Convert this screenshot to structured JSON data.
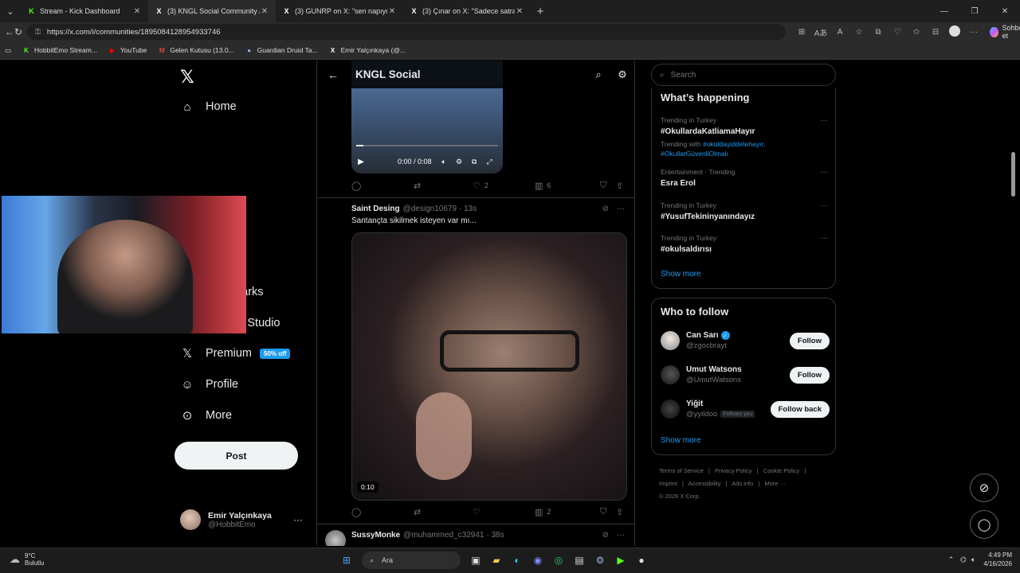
{
  "browser": {
    "tabs": [
      {
        "title": "Stream - Kick Dashboard",
        "icon": "K",
        "kind": "kick"
      },
      {
        "title": "(3) KNGL Social Community / X",
        "icon": "X",
        "kind": "x"
      },
      {
        "title": "(3) GUNRP on X: \"sen napıyordun",
        "icon": "X",
        "kind": "x"
      },
      {
        "title": "(3) Çınar on X: \"Sadece satranç atı",
        "icon": "X",
        "kind": "x"
      }
    ],
    "new_tab": "+",
    "url": "https://x.com/i/communities/1895084128954933746",
    "bookmarks": [
      {
        "label": "HobbitEmo Stream...",
        "icon": "K",
        "color": "#53fc18"
      },
      {
        "label": "YouTube",
        "icon": "▶",
        "color": "#ff0000"
      },
      {
        "label": "Gelen Kutusu (13.0...",
        "icon": "M",
        "color": "#ea4335"
      },
      {
        "label": "Guardian Druid Ta...",
        "icon": "●",
        "color": "#8fb4e8"
      },
      {
        "label": "Emir Yalçınkaya (@...",
        "icon": "X",
        "color": "#ffffff"
      }
    ],
    "copilot_label": "Sohbet et"
  },
  "nav": {
    "items": [
      {
        "label": "Home",
        "icon": "home-icon"
      },
      {
        "label": "Bookmarks",
        "icon": "bookmark-icon"
      },
      {
        "label": "Creator Studio",
        "icon": "rocket-icon"
      },
      {
        "label": "Premium",
        "icon": "x-icon"
      },
      {
        "label": "Profile",
        "icon": "person-icon"
      },
      {
        "label": "More",
        "icon": "more-circle-icon"
      }
    ],
    "premium_badge": "50% off",
    "post_label": "Post",
    "account": {
      "name": "Emir Yalçınkaya",
      "handle": "@HobbitEmo"
    }
  },
  "timeline": {
    "title": "KNGL Social",
    "video1": {
      "time": "0:00 / 0:08",
      "progress": 0.05
    },
    "tweet1_stats": {
      "likes": "2",
      "views": "6"
    },
    "tweet2": {
      "name": "Saint Desing",
      "handle": "@design10679",
      "time": "· 13s",
      "text": "Santançta sikilmek isteyen var mı...",
      "video_duration": "0:10",
      "views": "2"
    },
    "tweet3": {
      "name": "SussyMonke",
      "handle": "@muhammed_c32941",
      "time": "· 38s"
    }
  },
  "sidebar": {
    "search_placeholder": "Search",
    "happening_title": "What’s happening",
    "trends": [
      {
        "context": "Trending in Turkey",
        "title": "#OkullardaKatliamaHayır",
        "with_label": "Trending with",
        "with": "#okuldaşiddetehayır, #OkullarGüvenliOlmalı"
      },
      {
        "context": "Entertainment · Trending",
        "title": "Esra Erol"
      },
      {
        "context": "Trending in Turkey",
        "title": "#YusufTekininyanındayız"
      },
      {
        "context": "Trending in Turkey",
        "title": "#okulsaldırısı"
      }
    ],
    "show_more": "Show more",
    "who_to_follow_title": "Who to follow",
    "follow": [
      {
        "name": "Can Sarı",
        "handle": "@zgocbrayt",
        "verified": true,
        "button": "Follow",
        "follows_you": ""
      },
      {
        "name": "Umut Watsons",
        "handle": "@UmutWatsons",
        "verified": false,
        "button": "Follow",
        "follows_you": ""
      },
      {
        "name": "Yiğit",
        "handle": "@yyildoo",
        "verified": false,
        "button": "Follow back",
        "follows_you": "Follows you"
      }
    ],
    "footer": [
      "Terms of Service",
      "|",
      "Privacy Policy",
      "|",
      "Cookie Policy",
      "|",
      "Imprint",
      "|",
      "Accessibility",
      "|",
      "Ads info",
      "|",
      "More ···",
      "© 2026 X Corp."
    ]
  },
  "taskbar": {
    "weather_temp": "9°C",
    "weather_text": "Bulutlu",
    "search_placeholder": "Ara",
    "time": "4:49 PM",
    "date": "4/16/2026"
  },
  "colors": {
    "accent": "#1d9bf0",
    "background": "#000000",
    "border": "#2f3336",
    "muted": "#71767b"
  }
}
